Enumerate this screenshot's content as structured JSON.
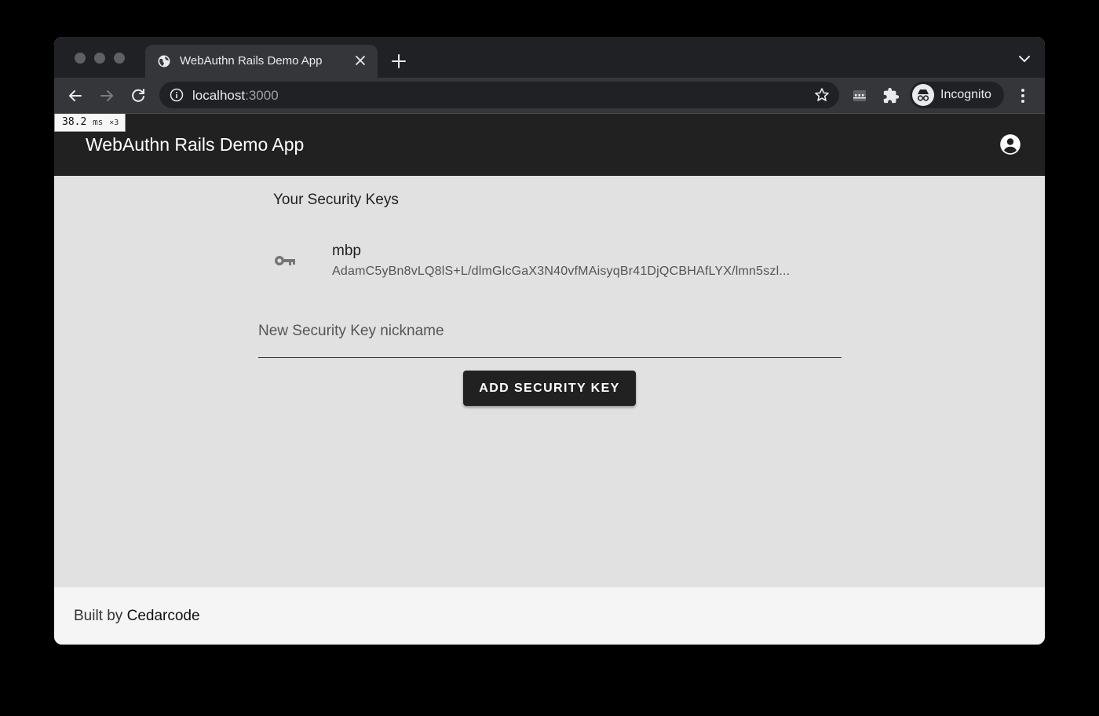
{
  "browser": {
    "tab_title": "WebAuthn Rails Demo App",
    "url_host": "localhost",
    "url_port": ":3000",
    "profile_label": "Incognito"
  },
  "perf_badge": {
    "value": "38.2",
    "unit": "ms",
    "count": "×3"
  },
  "app": {
    "title": "WebAuthn Rails Demo App"
  },
  "security_keys": {
    "heading": "Your Security Keys",
    "items": [
      {
        "nickname": "mbp",
        "credential_id": "AdamC5yBn8vLQ8lS+L/dlmGlcGaX3N40vfMAisyqBr41DjQCBHAfLYX/lmn5szl..."
      }
    ]
  },
  "form": {
    "nickname_placeholder": "New Security Key nickname",
    "nickname_value": "",
    "add_button_label": "ADD SECURITY KEY"
  },
  "footer": {
    "prefix": "Built by ",
    "link_text": "Cedarcode"
  },
  "colors": {
    "app_bar": "#212121",
    "content_bg": "#e1e1e1",
    "footer_bg": "#f5f5f5",
    "button_bg": "#212121"
  }
}
